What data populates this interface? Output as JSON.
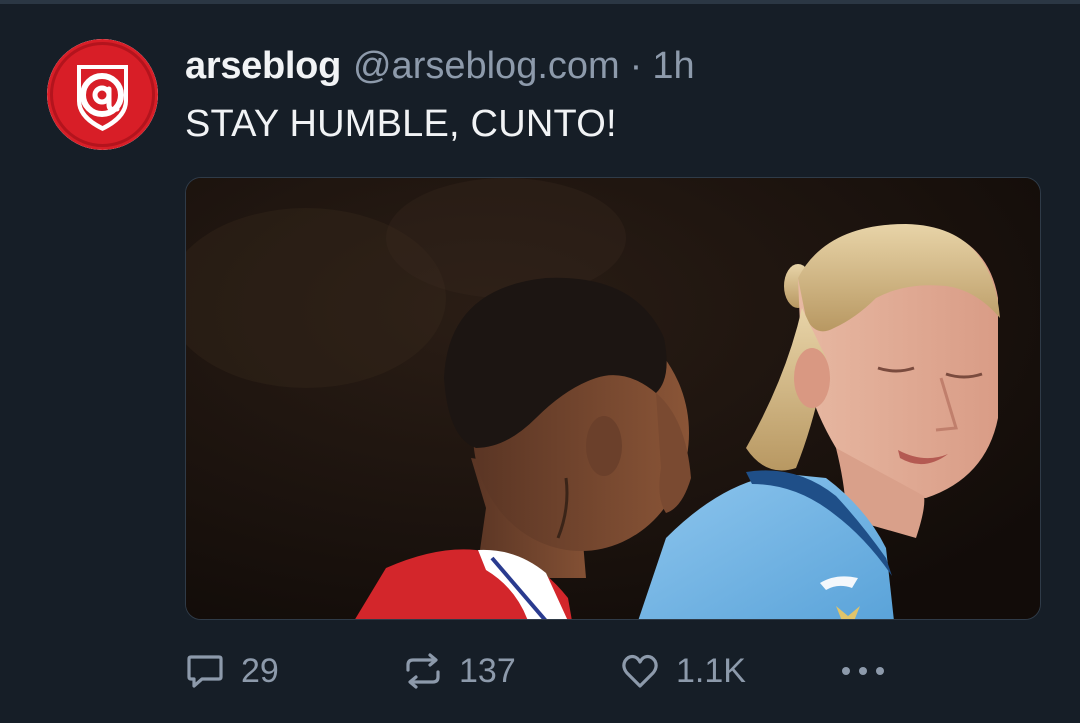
{
  "post": {
    "author": {
      "display_name": "arseblog",
      "handle": "@arseblog.com",
      "separator": "·",
      "timestamp": "1h",
      "avatar_icon": "arsenal-a-crest-icon"
    },
    "text": "STAY HUMBLE, CUNTO!",
    "media": {
      "type": "photo"
    },
    "actions": {
      "reply": {
        "icon": "speech-bubble-icon",
        "count": "29"
      },
      "repost": {
        "icon": "repost-arrows-icon",
        "count": "137"
      },
      "like": {
        "icon": "heart-icon",
        "count": "1.1K"
      },
      "more": {
        "icon": "ellipsis-icon"
      }
    }
  },
  "colors": {
    "background": "#161e27",
    "primary_text": "#f1f3f5",
    "secondary_text": "#8d9aab",
    "avatar_red": "#d81e27"
  }
}
